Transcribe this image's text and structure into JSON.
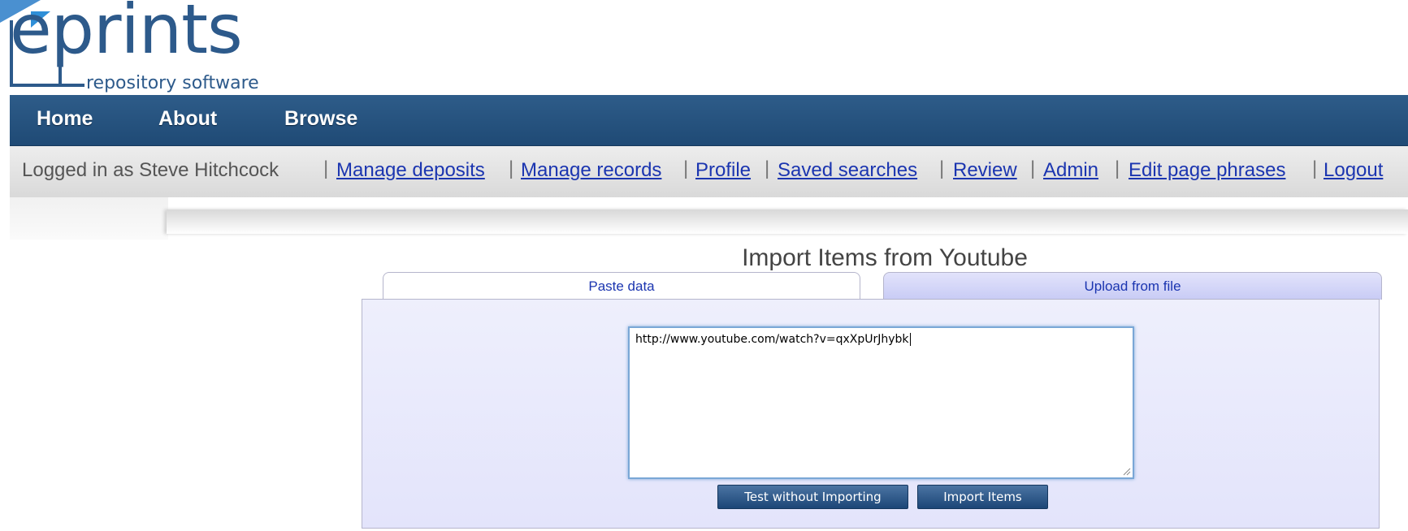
{
  "logo": {
    "wordmark": "eprints",
    "tagline": "repository software"
  },
  "topnav": {
    "items": [
      {
        "label": "Home"
      },
      {
        "label": "About"
      },
      {
        "label": "Browse"
      }
    ]
  },
  "userbar": {
    "logged_in": "Logged in as Steve Hitchcock",
    "links": [
      {
        "label": "Manage deposits"
      },
      {
        "label": "Manage records"
      },
      {
        "label": "Profile"
      },
      {
        "label": "Saved searches"
      },
      {
        "label": "Review"
      },
      {
        "label": "Admin"
      },
      {
        "label": "Edit page phrases"
      },
      {
        "label": "Logout"
      }
    ]
  },
  "main": {
    "title": "Import Items from Youtube",
    "tabs": [
      {
        "label": "Paste data",
        "active": true
      },
      {
        "label": "Upload from file",
        "active": false
      }
    ],
    "paste_value": "http://www.youtube.com/watch?v=qxXpUrJhybk",
    "buttons": {
      "test": "Test without Importing",
      "import": "Import Items"
    }
  },
  "colors": {
    "brand": "#2d5a8b",
    "nav_bg": "#26527f",
    "link": "#1b35b0",
    "panel_bg": "#e8e9fc"
  },
  "icons": {
    "logo_bracket": "logo-bracket-icon",
    "resize": "resize-grip-icon"
  }
}
